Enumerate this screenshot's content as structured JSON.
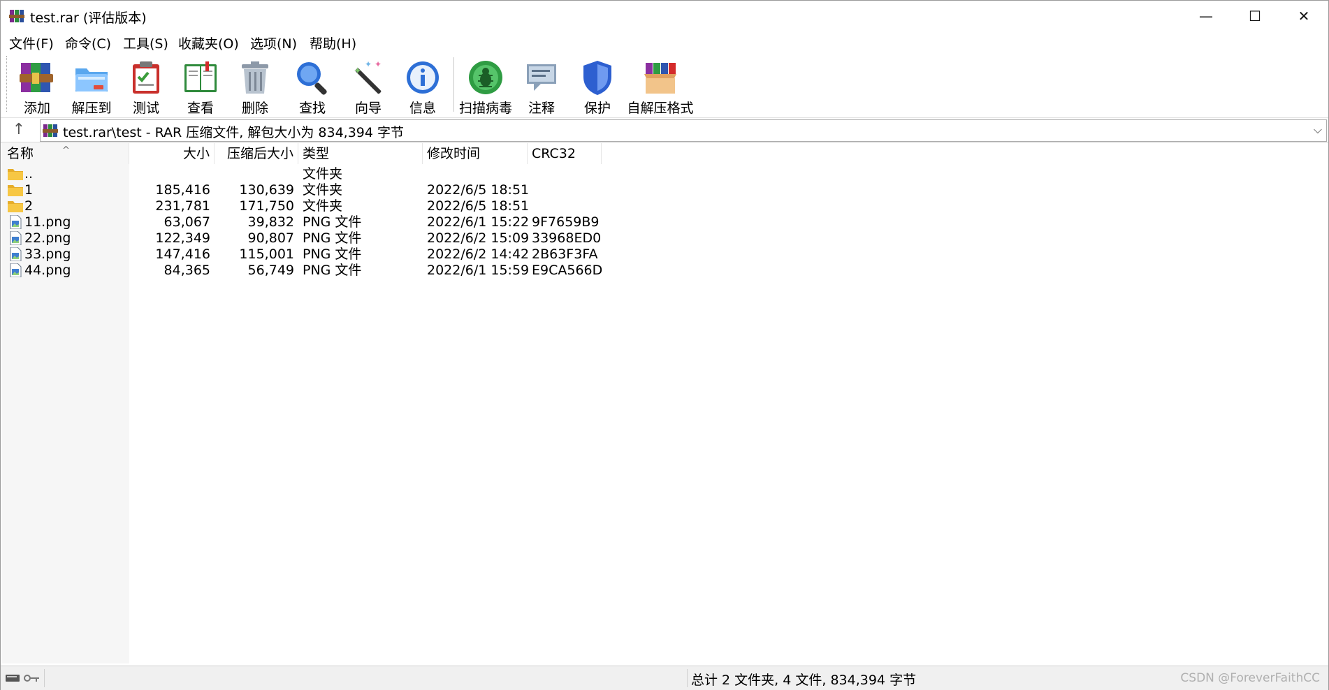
{
  "window": {
    "title": "test.rar (评估版本)"
  },
  "window_controls": {
    "minimize": "—",
    "maximize": "☐",
    "close": "✕"
  },
  "menu": [
    "文件(F)",
    "命令(C)",
    "工具(S)",
    "收藏夹(O)",
    "选项(N)",
    "帮助(H)"
  ],
  "toolbar": [
    {
      "label": "添加",
      "icon": "add-archive-icon"
    },
    {
      "label": "解压到",
      "icon": "extract-folder-icon"
    },
    {
      "label": "测试",
      "icon": "test-clipboard-icon"
    },
    {
      "label": "查看",
      "icon": "view-book-icon"
    },
    {
      "label": "删除",
      "icon": "trash-icon"
    },
    {
      "label": "查找",
      "icon": "magnifier-icon"
    },
    {
      "label": "向导",
      "icon": "wizard-wand-icon"
    },
    {
      "label": "信息",
      "icon": "info-icon"
    },
    {
      "label": "扫描病毒",
      "icon": "virus-scan-icon"
    },
    {
      "label": "注释",
      "icon": "comment-icon"
    },
    {
      "label": "保护",
      "icon": "shield-icon"
    },
    {
      "label": "自解压格式",
      "icon": "sfx-box-icon"
    }
  ],
  "address": {
    "up": "↑",
    "path": "test.rar\\test - RAR 压缩文件, 解包大小为 834,394 字节",
    "dropdown": "⌵"
  },
  "columns": {
    "name": "名称",
    "size": "大小",
    "packed": "压缩后大小",
    "type": "类型",
    "mtime": "修改时间",
    "crc": "CRC32",
    "sort_indicator": "^"
  },
  "files": [
    {
      "icon": "folder-up-icon",
      "name": "..",
      "size": "",
      "packed": "",
      "type": "文件夹",
      "mtime": "",
      "crc": ""
    },
    {
      "icon": "folder-icon",
      "name": "1",
      "size": "185,416",
      "packed": "130,639",
      "type": "文件夹",
      "mtime": "2022/6/5 18:51",
      "crc": ""
    },
    {
      "icon": "folder-icon",
      "name": "2",
      "size": "231,781",
      "packed": "171,750",
      "type": "文件夹",
      "mtime": "2022/6/5 18:51",
      "crc": ""
    },
    {
      "icon": "png-file-icon",
      "name": "11.png",
      "size": "63,067",
      "packed": "39,832",
      "type": "PNG 文件",
      "mtime": "2022/6/1 15:22",
      "crc": "9F7659B9"
    },
    {
      "icon": "png-file-icon",
      "name": "22.png",
      "size": "122,349",
      "packed": "90,807",
      "type": "PNG 文件",
      "mtime": "2022/6/2 15:09",
      "crc": "33968ED0"
    },
    {
      "icon": "png-file-icon",
      "name": "33.png",
      "size": "147,416",
      "packed": "115,001",
      "type": "PNG 文件",
      "mtime": "2022/6/2 14:42",
      "crc": "2B63F3FA"
    },
    {
      "icon": "png-file-icon",
      "name": "44.png",
      "size": "84,365",
      "packed": "56,749",
      "type": "PNG 文件",
      "mtime": "2022/6/1 15:59",
      "crc": "E9CA566D"
    }
  ],
  "status": {
    "summary": "总计 2 文件夹, 4 文件, 834,394 字节",
    "watermark": "CSDN @ForeverFaithCC"
  },
  "colors": {
    "folder": "#f7c744",
    "selection_bg": "#f6f6f6",
    "status_bg": "#f0f0f0"
  }
}
